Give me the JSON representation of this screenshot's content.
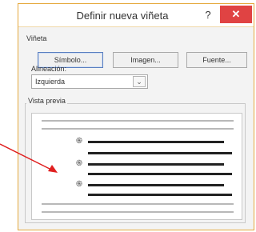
{
  "dialog": {
    "title": "Definir nueva viñeta",
    "help_label": "?",
    "close_label": "✕"
  },
  "bullet_section": {
    "label": "Viñeta",
    "symbol_button": "Símbolo...",
    "image_button": "Imagen...",
    "font_button": "Fuente..."
  },
  "alignment": {
    "label": "Alineación:",
    "value": "Izquierda",
    "arrow": "⌄"
  },
  "preview": {
    "label": "Vista previa",
    "bullet_glyph": "֍"
  },
  "colors": {
    "accent_border": "#e5a93d",
    "close_button": "#e04343",
    "annotation_arrow": "#e02020"
  },
  "icons": {
    "annotation": "red-arrow-icon",
    "bullet": "eye-bullet-icon"
  }
}
